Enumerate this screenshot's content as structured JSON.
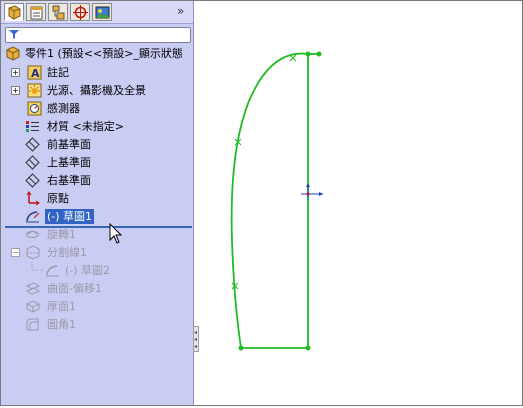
{
  "toolbar": {
    "tabs": [
      {
        "icon": "feature-manager-icon",
        "active": true
      },
      {
        "icon": "property-manager-icon",
        "active": false
      },
      {
        "icon": "configuration-manager-icon",
        "active": false
      },
      {
        "icon": "dimxpert-icon",
        "active": false
      },
      {
        "icon": "display-manager-icon",
        "active": false
      }
    ],
    "more": "»",
    "filter_icon": "filter-icon"
  },
  "tree": {
    "root": "零件1  (預設<<預設>_顯示狀態",
    "items": [
      {
        "label": "註記",
        "icon": "annotations-icon",
        "expandable": true,
        "dim": false
      },
      {
        "label": "光源、攝影機及全景",
        "icon": "lights-cameras-icon",
        "expandable": true,
        "dim": false
      },
      {
        "label": "感測器",
        "icon": "sensors-icon",
        "expandable": false,
        "dim": false
      },
      {
        "label": "材質 <未指定>",
        "icon": "material-icon",
        "expandable": false,
        "dim": false
      },
      {
        "label": "前基準面",
        "icon": "plane-icon",
        "expandable": false,
        "dim": false
      },
      {
        "label": "上基準面",
        "icon": "plane-icon",
        "expandable": false,
        "dim": false
      },
      {
        "label": "右基準面",
        "icon": "plane-icon",
        "expandable": false,
        "dim": false
      },
      {
        "label": "原點",
        "icon": "origin-icon",
        "expandable": false,
        "dim": false
      },
      {
        "label": "(-) 草圖1",
        "icon": "sketch-icon",
        "expandable": false,
        "dim": false,
        "selected": true
      },
      {
        "label": "旋轉1",
        "icon": "revolve-icon",
        "expandable": false,
        "dim": true
      },
      {
        "label": "分割線1",
        "icon": "split-line-icon",
        "expandable": true,
        "expanded": true,
        "dim": true
      },
      {
        "label": "(-) 草圖2",
        "icon": "sketch-icon",
        "expandable": false,
        "dim": true,
        "child": true
      },
      {
        "label": "曲面-偏移1",
        "icon": "offset-surface-icon",
        "expandable": false,
        "dim": true
      },
      {
        "label": "厚面1",
        "icon": "thicken-icon",
        "expandable": false,
        "dim": true
      },
      {
        "label": "圓角1",
        "icon": "fillet-icon",
        "expandable": false,
        "dim": true
      }
    ]
  },
  "colors": {
    "panel_bg": "#c9ccf3",
    "selection": "#3163c5",
    "sketch_line": "#22bb22",
    "rollback_bar": "#3668b8"
  }
}
